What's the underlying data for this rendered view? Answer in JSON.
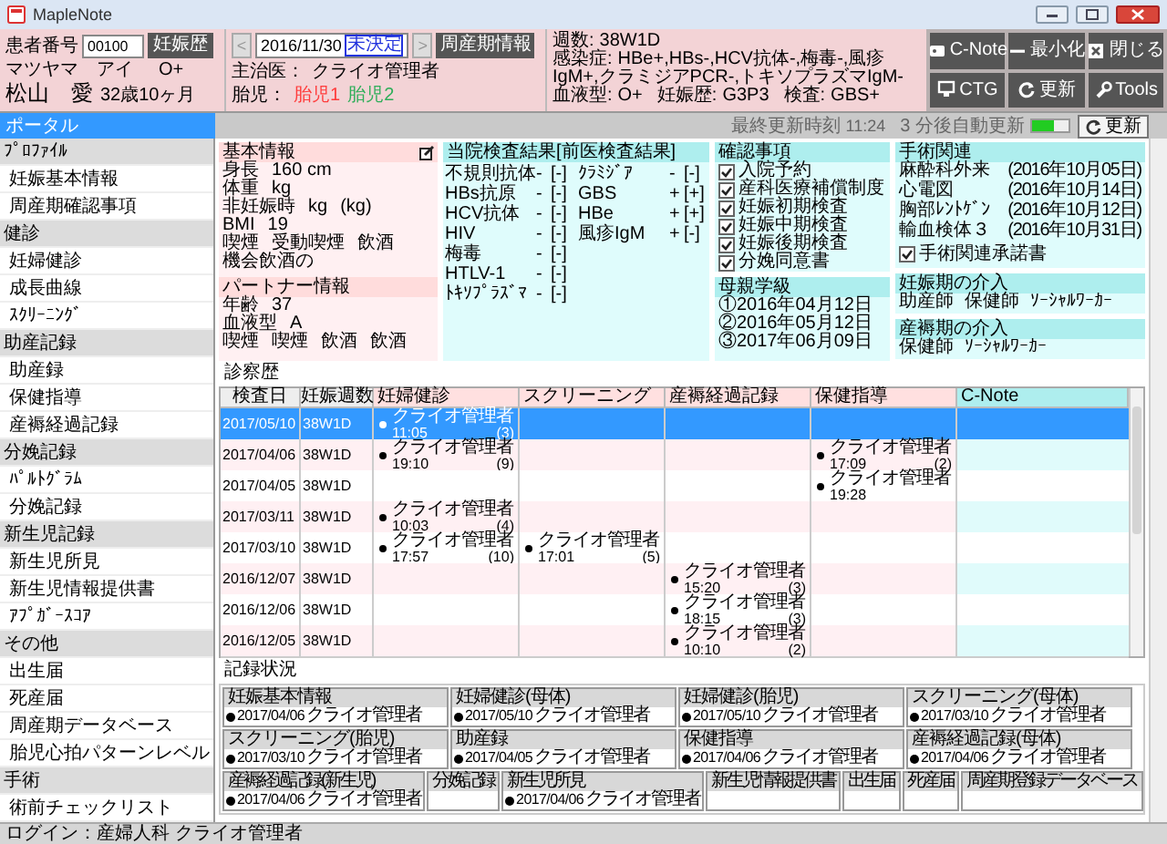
{
  "window": {
    "title": "MapleNote"
  },
  "patient": {
    "id_label": "患者番号",
    "id_value": "00100",
    "history_button": "妊娠歴",
    "kana": "マツヤマ　アイ",
    "blood": "O+",
    "name": "松山　愛",
    "age": "32歳10ヶ月"
  },
  "visit": {
    "prev": "<",
    "date": "2016/11/30",
    "date_status": "未決定",
    "next": ">",
    "perinatal_button": "周産期情報",
    "doctor_label": "主治医：",
    "doctor": "クライオ管理者",
    "fetus_label": "胎児：",
    "fetuses": [
      {
        "label": "胎児1",
        "color": "#ff3b3b"
      },
      {
        "label": "胎児2",
        "color": "#2fae5a"
      }
    ]
  },
  "summary": [
    {
      "label": "週数:",
      "value": "38W1D"
    },
    {
      "label": "感染症:",
      "value": "HBe+,HBs-,HCV抗体-,梅毒-,風疹IgM+,クラミジアPCR-,トキソプラズマIgM-"
    },
    {
      "label": "血液型:",
      "value": "O+"
    },
    {
      "label": "妊娠歴:",
      "value": "G3P3"
    },
    {
      "label": "検査:",
      "value": "GBS+"
    }
  ],
  "toolbar_buttons": [
    "C-Note",
    "最小化",
    "閉じる",
    "CTG",
    "更新",
    "Tools"
  ],
  "refresh": {
    "last_label": "最終更新時刻",
    "last_time": "11:24",
    "auto_text": "3 分後自動更新",
    "level": 0.6,
    "button": "更新"
  },
  "sidebar": {
    "tab": "ポータル",
    "groups": [
      {
        "label": "ﾌﾟﾛﾌｧｲﾙ",
        "children": [
          {
            "label": "妊娠基本情報"
          },
          {
            "label": "周産期確認事項"
          }
        ]
      },
      {
        "label": "健診",
        "children": [
          {
            "label": "妊婦健診"
          },
          {
            "label": "成長曲線"
          },
          {
            "label": "ｽｸﾘｰﾆﾝｸﾞ"
          }
        ]
      },
      {
        "label": "助産記録",
        "children": [
          {
            "label": "助産録"
          },
          {
            "label": "保健指導"
          },
          {
            "label": "産褥経過記録"
          }
        ]
      },
      {
        "label": "分娩記録",
        "children": [
          {
            "label": "ﾊﾟﾙﾄｸﾞﾗﾑ"
          },
          {
            "label": "分娩記録"
          }
        ]
      },
      {
        "label": "新生児記録",
        "children": [
          {
            "label": "新生児所見"
          },
          {
            "label": "新生児情報提供書"
          },
          {
            "label": "ｱﾌﾟｶﾞｰｽｺｱ"
          }
        ]
      },
      {
        "label": "その他",
        "children": [
          {
            "label": "出生届"
          },
          {
            "label": "死産届"
          },
          {
            "label": "周産期データベース"
          },
          {
            "label": "胎児心拍パターンレベル"
          }
        ]
      },
      {
        "label": "手術",
        "children": [
          {
            "label": "術前チェックリスト"
          }
        ]
      }
    ]
  },
  "basic_info": {
    "title": "基本情報",
    "rows": [
      [
        "身長",
        "160 cm"
      ],
      [
        "体重",
        "kg"
      ],
      [
        "非妊娠時",
        "kg",
        "(kg)"
      ],
      [
        "BMI",
        "19"
      ],
      [
        "喫煙",
        "受動喫煙",
        "飲酒",
        "機会飲酒の"
      ]
    ]
  },
  "partner_info": {
    "title": "パートナー情報",
    "rows": [
      [
        "年齢",
        "37"
      ],
      [
        "血液型",
        "A"
      ],
      [
        "喫煙",
        "喫煙",
        "飲酒",
        "飲酒"
      ]
    ]
  },
  "lab_results": {
    "title": "当院検査結果[前医検査結果]",
    "columns": [
      [
        {
          "name": "不規則抗体",
          "result": "-",
          "prior": "[-]"
        },
        {
          "name": "HBs抗原",
          "result": "-",
          "prior": "[-]"
        },
        {
          "name": "HCV抗体",
          "result": "-",
          "prior": "[-]"
        },
        {
          "name": "HIV",
          "result": "-",
          "prior": "[-]"
        },
        {
          "name": "梅毒",
          "result": "-",
          "prior": "[-]"
        },
        {
          "name": "HTLV-1",
          "result": "-",
          "prior": "[-]"
        },
        {
          "name": "ﾄｷｿﾌﾟﾗｽﾞﾏ",
          "result": "-",
          "prior": "[-]"
        }
      ],
      [
        {
          "name": "ｸﾗﾐｼﾞｱ",
          "result": "-",
          "prior": "[-]"
        },
        {
          "name": "GBS",
          "result": "+",
          "prior": "[+]"
        },
        {
          "name": "HBe",
          "result": "+",
          "prior": "[+]"
        },
        {
          "name": "風疹IgM",
          "result": "+",
          "prior": "[-]"
        }
      ]
    ]
  },
  "checks": {
    "title": "確認事項",
    "items": [
      {
        "label": "入院予約",
        "checked": true
      },
      {
        "label": "産科医療補償制度",
        "checked": true
      },
      {
        "label": "妊娠初期検査",
        "checked": true
      },
      {
        "label": "妊娠中期検査",
        "checked": true
      },
      {
        "label": "妊娠後期検査",
        "checked": true
      },
      {
        "label": "分娩同意書",
        "checked": true
      }
    ]
  },
  "surgery": {
    "title": "手術関連",
    "items": [
      {
        "label": "麻酔科外来",
        "date": "(2016年10月05日)"
      },
      {
        "label": "心電図",
        "date": "(2016年10月14日)"
      },
      {
        "label": "胸部ﾚﾝﾄｹﾞﾝ",
        "date": "(2016年10月12日)"
      },
      {
        "label": "輸血検体３",
        "date": "(2016年10月31日)"
      }
    ],
    "consent": {
      "label": "手術関連承諾書",
      "checked": true
    }
  },
  "mother_class": {
    "title": "母親学級",
    "items": [
      "①2016年04月12日",
      "②2016年05月12日",
      "③2017年06月09日"
    ]
  },
  "pregnancy_support": {
    "title": "妊娠期の介入",
    "items": [
      "助産師",
      "保健師",
      "ｿｰｼｬﾙﾜｰｶｰ"
    ]
  },
  "postpartum_support": {
    "title": "産褥期の介入",
    "items": [
      "保健師",
      "ｿｰｼｬﾙﾜｰｶｰ"
    ]
  },
  "history": {
    "title": "診察歴",
    "columns": [
      "検査日",
      "妊娠週数",
      "妊婦健診",
      "スクリーニング",
      "産褥経過記録",
      "保健指導",
      "C-Note"
    ],
    "rows": [
      {
        "date": "2017/05/10",
        "weeks": "38W1D",
        "selected": true,
        "checkup": {
          "author": "クライオ管理者",
          "time": "11:05",
          "count": "(3)"
        }
      },
      {
        "date": "2017/04/06",
        "weeks": "38W1D",
        "selected": false,
        "checkup": {
          "author": "クライオ管理者",
          "time": "19:10",
          "count": "(9)"
        },
        "guidance": {
          "author": "クライオ管理者",
          "time": "17:09",
          "count": "(2)"
        }
      },
      {
        "date": "2017/04/05",
        "weeks": "38W1D",
        "selected": false,
        "guidance": {
          "author": "クライオ管理者",
          "time": "19:28"
        }
      },
      {
        "date": "2017/03/11",
        "weeks": "38W1D",
        "selected": false,
        "checkup": {
          "author": "クライオ管理者",
          "time": "10:03",
          "count": "(4)"
        }
      },
      {
        "date": "2017/03/10",
        "weeks": "38W1D",
        "selected": false,
        "checkup": {
          "author": "クライオ管理者",
          "time": "17:57",
          "count": "(10)"
        },
        "screening": {
          "author": "クライオ管理者",
          "time": "17:01",
          "count": "(5)"
        }
      },
      {
        "date": "2016/12/07",
        "weeks": "38W1D",
        "selected": false,
        "postpartum": {
          "author": "クライオ管理者",
          "time": "15:20",
          "count": "(3)"
        }
      },
      {
        "date": "2016/12/06",
        "weeks": "38W1D",
        "selected": false,
        "postpartum": {
          "author": "クライオ管理者",
          "time": "18:15",
          "count": "(3)"
        }
      },
      {
        "date": "2016/12/05",
        "weeks": "38W1D",
        "selected": false,
        "postpartum": {
          "author": "クライオ管理者",
          "time": "10:10",
          "count": "(2)"
        }
      }
    ]
  },
  "records": {
    "title": "記録状況",
    "items": [
      {
        "label": "妊娠基本情報",
        "date": "2017/04/06",
        "author": "クライオ管理者"
      },
      {
        "label": "妊婦健診(母体)",
        "date": "2017/05/10",
        "author": "クライオ管理者"
      },
      {
        "label": "妊婦健診(胎児)",
        "date": "2017/05/10",
        "author": "クライオ管理者"
      },
      {
        "label": "スクリーニング(母体)",
        "date": "2017/03/10",
        "author": "クライオ管理者"
      },
      {
        "label": "スクリーニング(胎児)",
        "date": "2017/03/10",
        "author": "クライオ管理者"
      },
      {
        "label": "助産録",
        "date": "2017/04/05",
        "author": "クライオ管理者"
      },
      {
        "label": "保健指導",
        "date": "2017/04/06",
        "author": "クライオ管理者"
      },
      {
        "label": "産褥経過記録(母体)",
        "date": "2017/04/06",
        "author": "クライオ管理者"
      },
      {
        "label": "産褥経過記録(新生児)",
        "date": "2017/04/06",
        "author": "クライオ管理者"
      },
      {
        "label": "分娩記録"
      },
      {
        "label": "新生児所見",
        "date": "2017/04/06",
        "author": "クライオ管理者"
      },
      {
        "label": "新生児情報提供書"
      },
      {
        "label": "出生届"
      },
      {
        "label": "死産届"
      },
      {
        "label": "周産期登録データベース"
      }
    ]
  },
  "status_bar": {
    "text": "ログイン：産婦人科 クライオ管理者"
  }
}
